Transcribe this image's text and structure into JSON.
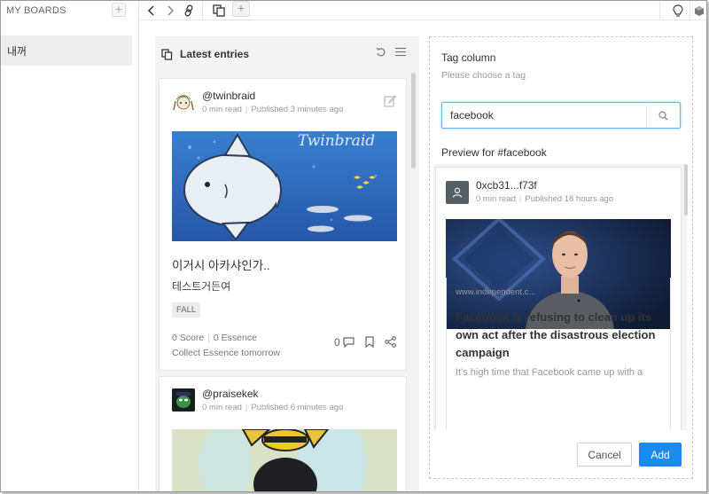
{
  "sidebar": {
    "title": "MY BOARDS",
    "add_icon": "plus-icon",
    "items": [
      {
        "label": "내꺼"
      }
    ]
  },
  "toolbar": {
    "icons": [
      "chevron-left-icon",
      "chevron-right-icon",
      "link-icon",
      "copy-icon",
      "plus-icon",
      "lightbulb-icon",
      "cube-icon"
    ]
  },
  "column": {
    "title": "Latest entries",
    "icons": [
      "entries-icon",
      "refresh-icon",
      "menu-icon"
    ],
    "entries": [
      {
        "username": "@twinbraid",
        "read_time": "0 min  read",
        "published": "Published 3 minutes ago",
        "image_text": "Twinbraid",
        "title": "이거시 아카샤인가..",
        "body": "테스트거든여",
        "tag": "FALL",
        "score": "0 Score",
        "essence": "0 Essence",
        "collect": "Collect Essence tomorrow",
        "comments": "0"
      },
      {
        "username": "@praisekek",
        "read_time": "0 min  read",
        "published": "Published 6 minutes ago"
      }
    ]
  },
  "tag_panel": {
    "title": "Tag column",
    "subtitle": "Please choose a tag",
    "search_value": "facebook",
    "preview_label": "Preview for #facebook",
    "preview": {
      "username": "0xcb31...f73f",
      "read_time": "0 min  read",
      "published": "Published 18 hours ago",
      "link_url": "www.independent.c...",
      "link_title": "Facebook is refusing to clean up its own act after the disastrous election campaign",
      "link_desc": "It's high time that Facebook came up with a"
    },
    "cancel_label": "Cancel",
    "add_label": "Add"
  },
  "colors": {
    "accent": "#1a8cf0",
    "focus_border": "#6cb4f0",
    "column_bg": "#f3f3f3"
  }
}
